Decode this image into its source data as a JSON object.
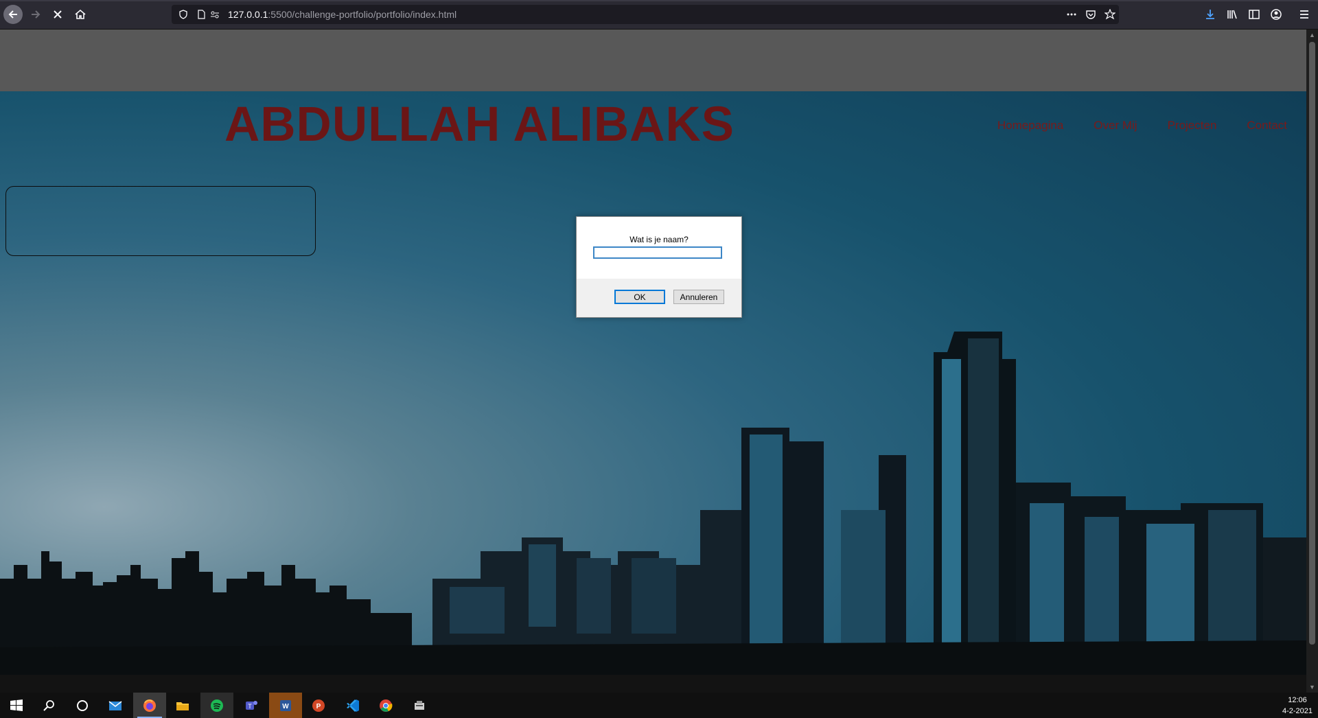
{
  "browser": {
    "url_host": "127.0.0.1",
    "url_path": ":5500/challenge-portfolio/portfolio/index.html"
  },
  "page": {
    "site_title": "ABDULLAH ALIBAKS",
    "nav": [
      "Homepagina",
      "Over Mij",
      "Projecten",
      "Contact"
    ]
  },
  "dialog": {
    "message": "Wat is je naam?",
    "input_value": "",
    "ok_label": "OK",
    "cancel_label": "Annuleren"
  },
  "taskbar": {
    "apps": [
      "start-icon",
      "search-icon",
      "cortana-icon",
      "mail-icon",
      "firefox-icon",
      "file-explorer-icon",
      "spotify-icon",
      "teams-icon",
      "word-icon",
      "powerpoint-icon",
      "vscode-icon",
      "chrome-icon",
      "misc-app-icon"
    ],
    "time": "12:06",
    "date": "4-2-2021"
  },
  "colors": {
    "title": "#6b1616",
    "nav": "#7a1a1a",
    "page_top_band": "#585858",
    "sky": "#17526c",
    "dialog_focus": "#0078d7"
  }
}
